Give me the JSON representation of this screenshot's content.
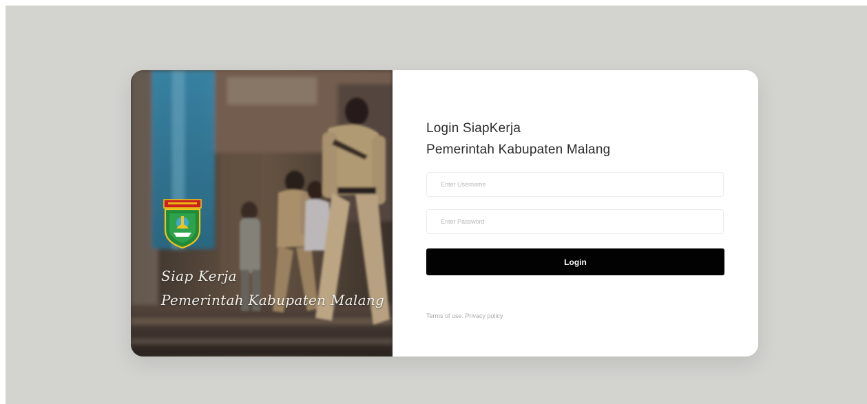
{
  "photo_panel": {
    "script_line_1": "Siap Kerja",
    "script_line_2": "Pemerintah Kabupaten Malang",
    "logo_icon": "kabupaten-malang-crest-icon"
  },
  "login_form": {
    "title_line_1": "Login SiapKerja",
    "title_line_2": "Pemerintah Kabupaten Malang",
    "username_placeholder": "Enter Username",
    "username_value": "",
    "password_placeholder": "Enter Password",
    "password_value": "",
    "login_label": "Login",
    "terms_label": "Terms of use.",
    "privacy_label": "Privacy policy"
  },
  "colors": {
    "page_background": "#d3d3d0",
    "card_background": "#ffffff",
    "button_background": "#020202",
    "button_text": "#ffffff",
    "logo_green": "#1f8a3a",
    "logo_yellow": "#f2c417",
    "logo_red": "#c9221c"
  }
}
